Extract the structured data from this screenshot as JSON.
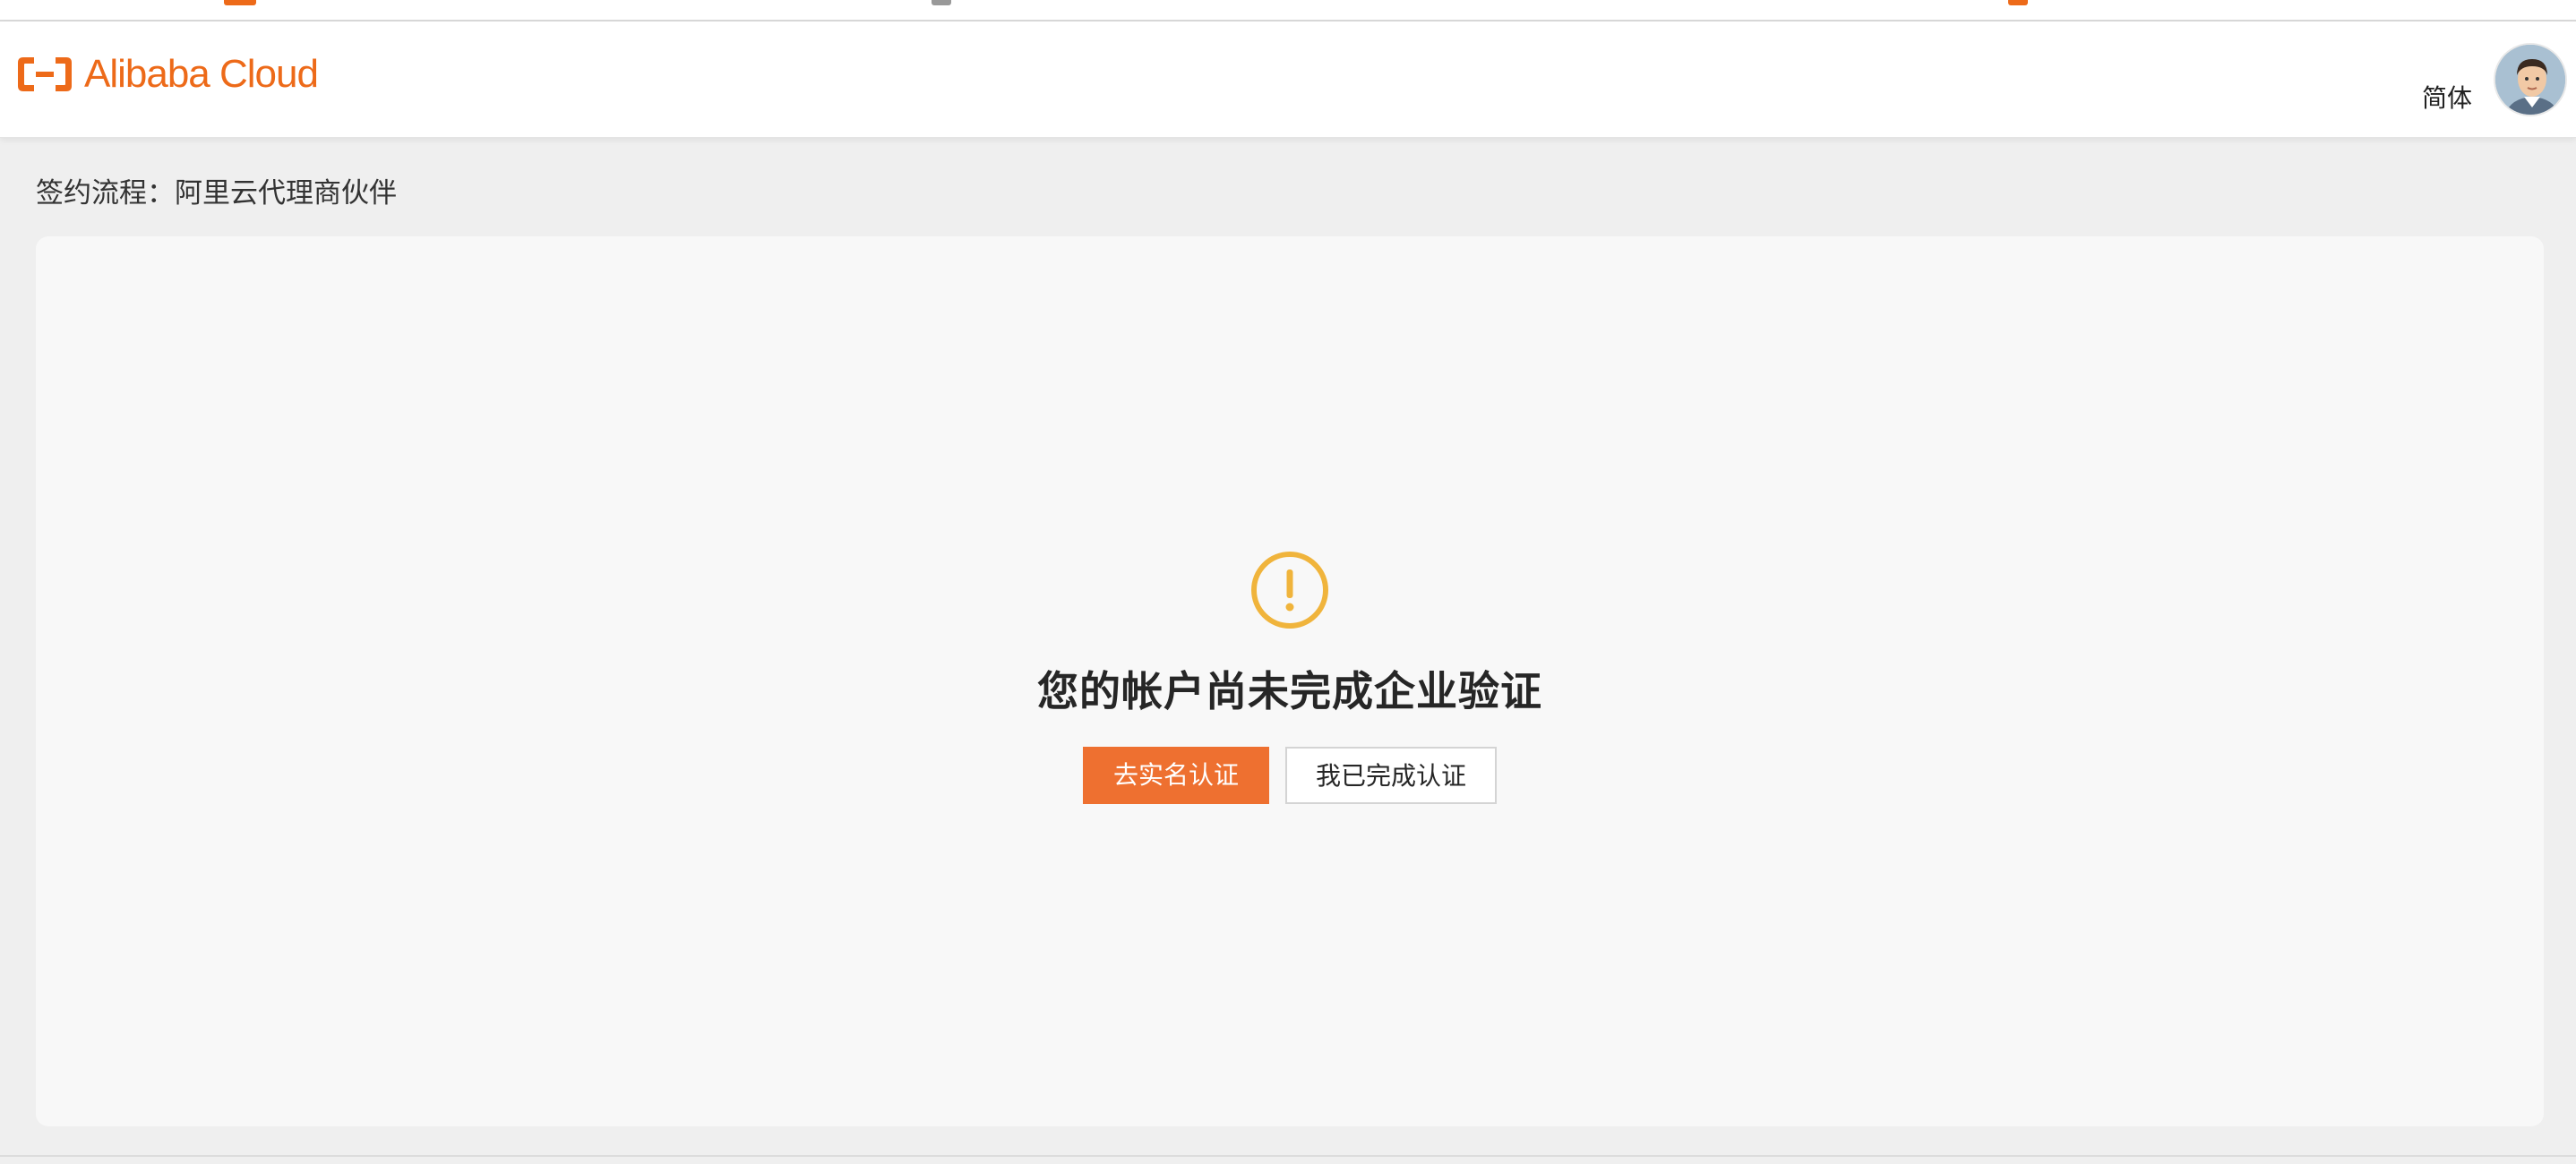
{
  "header": {
    "logo_text": "Alibaba Cloud",
    "language_label": "简体"
  },
  "page": {
    "title": "签约流程：阿里云代理商伙伴"
  },
  "notice": {
    "icon": "warning-circle-icon",
    "message": "您的帐户尚未完成企业验证",
    "primary_button": "去实名认证",
    "secondary_button": "我已完成认证"
  },
  "colors": {
    "brand": "#ed6a19",
    "primary_button": "#ee7030",
    "warning_icon": "#f0b43c",
    "page_background": "#efefef",
    "panel_background": "#f8f8f8"
  }
}
